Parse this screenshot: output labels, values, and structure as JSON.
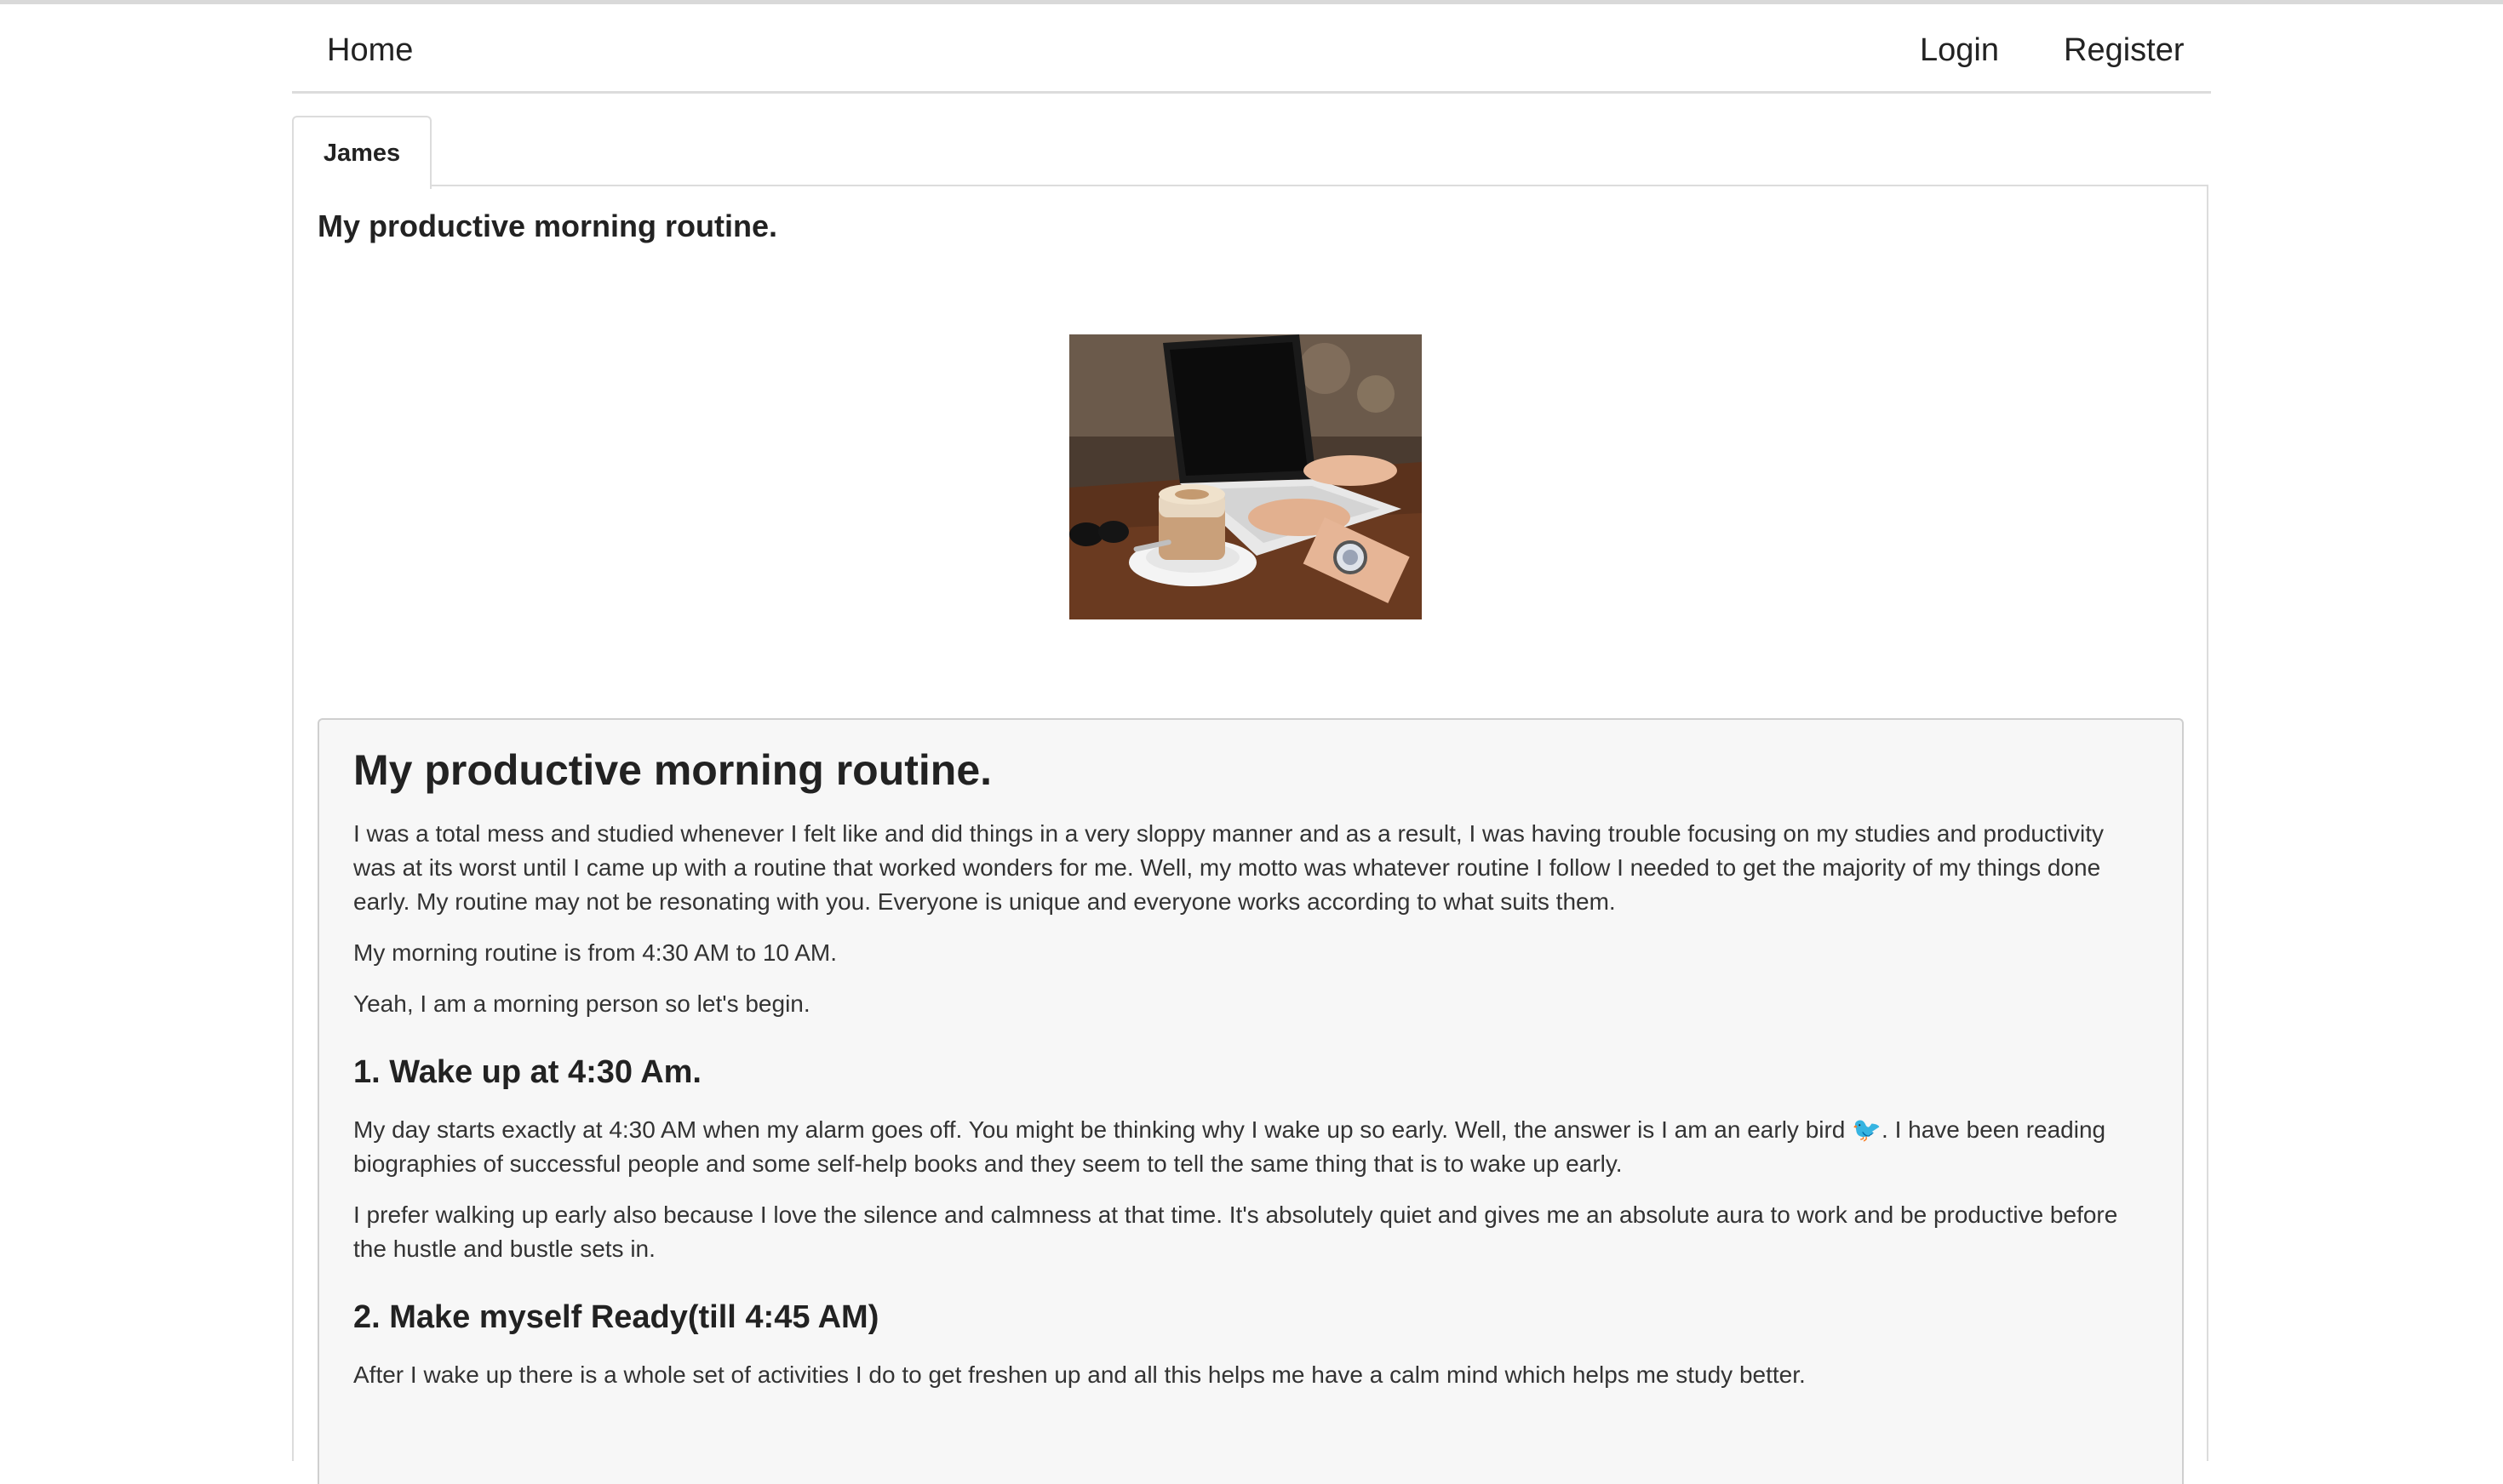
{
  "nav": {
    "home": "Home",
    "login": "Login",
    "register": "Register"
  },
  "tab": {
    "author": "James"
  },
  "post": {
    "title": "My productive morning routine.",
    "image_alt": "laptop-and-coffee-image"
  },
  "article": {
    "heading": "My productive morning routine.",
    "intro": "I was a total mess and studied whenever I felt like and did things in a very sloppy manner and as a result, I was having trouble focusing on my studies and productivity was at its worst until I came up with a routine that worked wonders for me. Well, my motto was whatever routine I follow I needed to get the majority of my things done early. My routine may not be resonating with you. Everyone is unique and everyone works according to what suits them.",
    "time_range": "My morning routine is from 4:30 AM to 10 AM.",
    "begin": "Yeah, I am a morning person so let's begin.",
    "section1_title": "1. Wake up at 4:30 Am.",
    "section1_p1": "My day starts exactly at 4:30 AM when my alarm goes off. You might be thinking why I wake up so early. Well, the answer is I am an early bird 🐦. I have been reading biographies of successful people and some self-help books and they seem to tell the same thing that is to wake up early.",
    "section1_p2": "I prefer walking up early also because I love the silence and calmness at that time. It's absolutely quiet and gives me an absolute aura to work and be productive before the hustle and bustle sets in.",
    "section2_title": "2. Make myself Ready(till 4:45 AM)",
    "section2_p1": "After I wake up there is a whole set of activities I do to get freshen up and all this helps me have a calm mind which helps me study better."
  }
}
